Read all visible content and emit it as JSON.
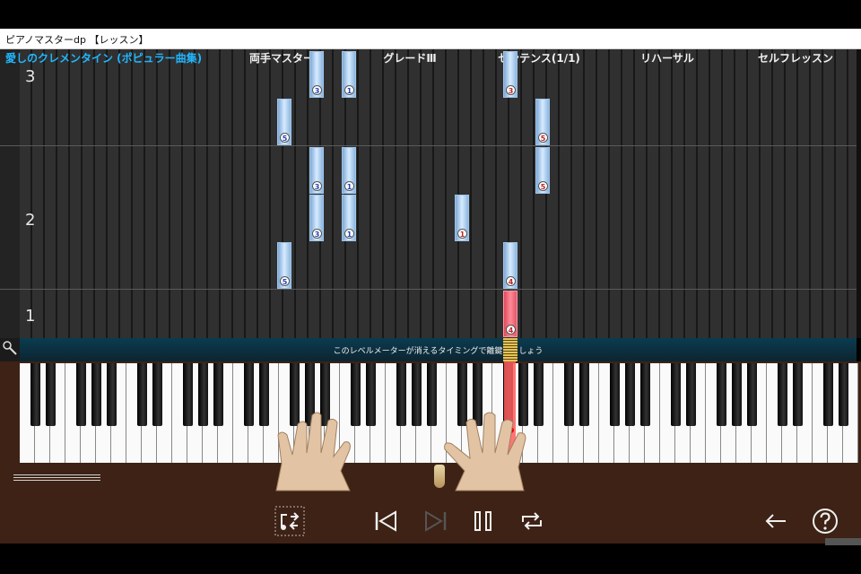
{
  "window": {
    "title": "ピアノマスターdp 【レッスン】"
  },
  "header": {
    "song_title": "愛しのクレメンタイン (ポピュラー曲集)",
    "menu": [
      "両手マスター",
      "グレードⅢ",
      "センテンス(1/1)",
      "リハーサル",
      "セルフレッスン"
    ]
  },
  "measures": [
    "3",
    "2",
    "1"
  ],
  "notes": [
    {
      "finger": "3",
      "hand": "left"
    },
    {
      "finger": "1",
      "hand": "left"
    },
    {
      "finger": "3",
      "hand": "right"
    },
    {
      "finger": "5",
      "hand": "left"
    },
    {
      "finger": "5",
      "hand": "right"
    },
    {
      "finger": "3",
      "hand": "left"
    },
    {
      "finger": "1",
      "hand": "left"
    },
    {
      "finger": "5",
      "hand": "right"
    },
    {
      "finger": "3",
      "hand": "left"
    },
    {
      "finger": "1",
      "hand": "left"
    },
    {
      "finger": "1",
      "hand": "right"
    },
    {
      "finger": "5",
      "hand": "left"
    },
    {
      "finger": "4",
      "hand": "right"
    },
    {
      "finger": "4",
      "hand": "right",
      "active": true
    }
  ],
  "meter": {
    "message": "このレベルメーターが消えるタイミングで離鍵しましょう"
  },
  "controls": {
    "repeat_section": "repeat-section-icon",
    "prev": "skip-previous-icon",
    "next": "skip-next-icon",
    "pause": "pause-icon",
    "loop": "loop-icon",
    "back": "back-arrow-icon",
    "help": "help-icon"
  },
  "colors": {
    "accent": "#21b7ff",
    "active_key": "#ff5d5d",
    "note": "#a9cff2",
    "wood": "#3d2215"
  }
}
